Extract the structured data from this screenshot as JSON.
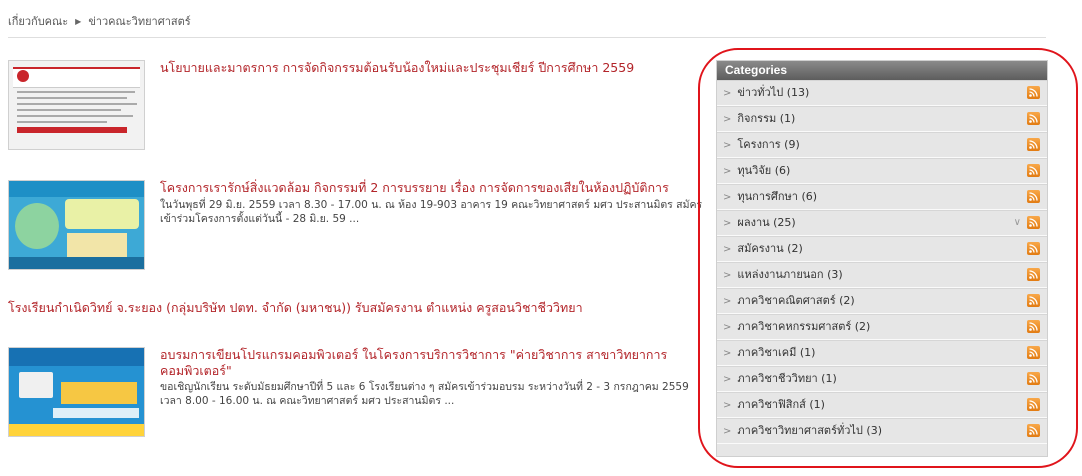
{
  "breadcrumb": {
    "home": "เกี่ยวกับคณะ",
    "current": "ข่าวคณะวิทยาศาสตร์"
  },
  "posts": [
    {
      "title": "นโยบายและมาตรการ การจัดกิจกรรมต้อนรับน้องใหม่และประชุมเชียร์ ปีการศึกษา 2559",
      "desc": ""
    },
    {
      "title": "โครงการเรารักษ์สิ่งแวดล้อม กิจกรรมที่ 2 การบรรยาย เรื่อง การจัดการของเสียในห้องปฏิบัติการ",
      "desc_line1": "ในวันพุธที่ 29 มิ.ย. 2559 เวลา 8.30 - 17.00 น. ณ ห้อง 19-903 อาคาร 19 คณะวิทยาศาสตร์ มศว ประสานมิตร สมัคร",
      "desc_line2": "เข้าร่วมโครงการตั้งแต่วันนี้ - 28 มิ.ย. 59 ..."
    },
    {
      "title": "โรงเรียนกำเนิดวิทย์ จ.ระยอง (กลุ่มบริษัท ปตท. จำกัด (มหาชน)) รับสมัครงาน ตำแหน่ง ครูสอนวิชาชีววิทยา"
    },
    {
      "title_line1": "อบรมการเขียนโปรแกรมคอมพิวเตอร์ ในโครงการบริการวิชาการ \"ค่ายวิชาการ สาขาวิทยาการ",
      "title_line2": "คอมพิวเตอร์\"",
      "desc_line1": "ขอเชิญนักเรียน ระดับมัธยมศึกษาปีที่ 5 และ 6 โรงเรียนต่าง ๆ สมัครเข้าร่วมอบรม ระหว่างวันที่ 2 - 3 กรกฎาคม 2559",
      "desc_line2": "เวลา 8.00 - 16.00 น. ณ คณะวิทยาศาสตร์ มศว ประสานมิตร ..."
    }
  ],
  "categories": {
    "header": "Categories",
    "items": [
      "ข่าวทั่วไป (13)",
      "กิจกรรม (1)",
      "โครงการ (9)",
      "ทุนวิจัย (6)",
      "ทุนการศึกษา (6)",
      "ผลงาน (25)",
      "สมัครงาน (2)",
      "แหล่งงานภายนอก (3)",
      "ภาควิชาคณิตศาสตร์ (2)",
      "ภาควิชาคหกรรมศาสตร์ (2)",
      "ภาควิชาเคมี (1)",
      "ภาควิชาชีววิทยา (1)",
      "ภาควิชาฟิสิกส์ (1)",
      "ภาควิชาวิทยาศาสตร์ทั่วไป (3)"
    ]
  },
  "colors": {
    "title_red": "#b3252a",
    "rss_orange": "#e27b12",
    "annotation_red": "#e0141b"
  }
}
